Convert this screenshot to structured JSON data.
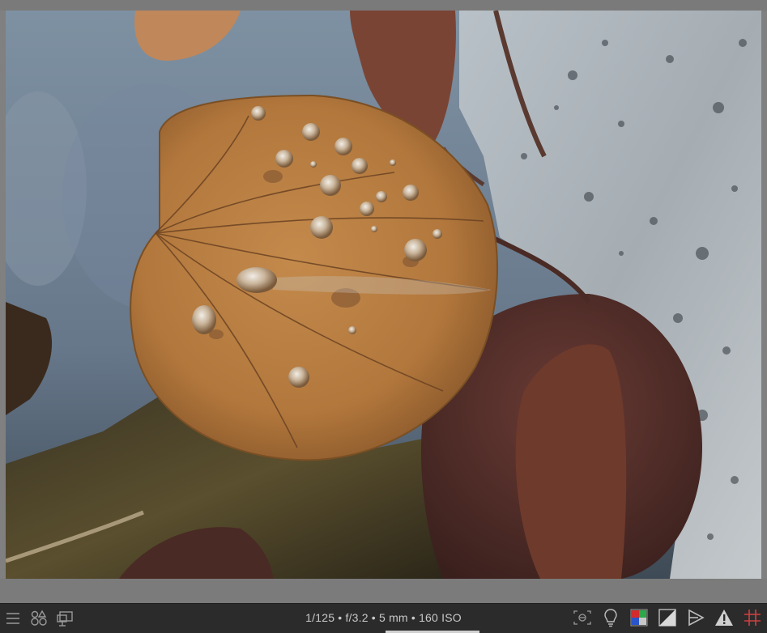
{
  "app": {
    "accent_color": "#cfcfcf",
    "background_color": "#808080",
    "bar_color": "#2b2b2b"
  },
  "image": {
    "subject": "wet autumn leaves with water droplets on stone in shallow water",
    "colors": {
      "leaf_main": "#b87a3d",
      "leaf_dark": "#5a2e2a",
      "stone": "#aeb6bc",
      "water": "#6f8193"
    }
  },
  "bottom_bar": {
    "exif_info": "1/125 • f/3.2 • 5 mm • 160 ISO",
    "left_icons": [
      "hamburger-menu-icon",
      "styles-icon",
      "display-icon"
    ],
    "right_icons": [
      "focus-peaking-icon",
      "color-assessment-icon",
      "soft-proof-icon",
      "overexposure-icon",
      "gamut-check-icon",
      "raw-overexposed-icon",
      "guides-icon"
    ]
  }
}
